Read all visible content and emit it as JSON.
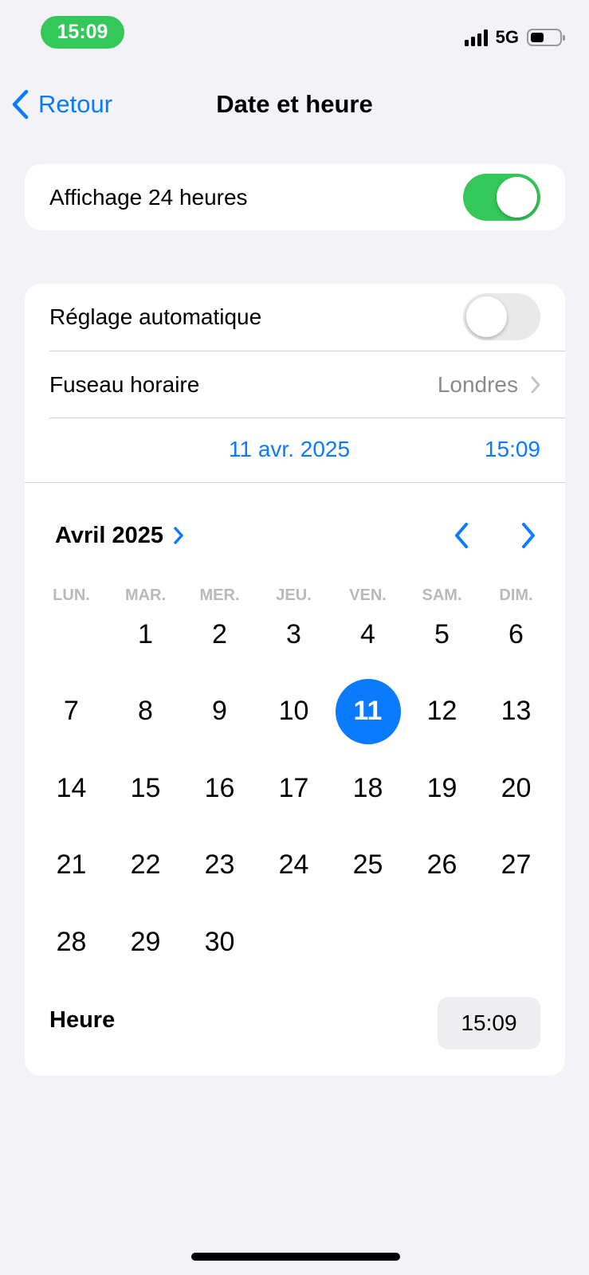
{
  "status_bar": {
    "time": "15:09",
    "network": "5G",
    "signal_bars": 4,
    "battery_level": 0.46
  },
  "nav": {
    "back_label": "Retour",
    "title": "Date et heure",
    "back_icon": "chevron-left-icon"
  },
  "settings": {
    "h24_label": "Affichage 24 heures",
    "h24_on": true,
    "auto_label": "Réglage automatique",
    "auto_on": false,
    "timezone_label": "Fuseau horaire",
    "timezone_value": "Londres"
  },
  "selected_datetime": {
    "date": "11 avr. 2025",
    "time": "15:09"
  },
  "calendar": {
    "month_label": "Avril 2025",
    "weekdays": [
      "LUN.",
      "MAR.",
      "MER.",
      "JEU.",
      "VEN.",
      "SAM.",
      "DIM."
    ],
    "first_weekday_offset": 1,
    "days": [
      "1",
      "2",
      "3",
      "4",
      "5",
      "6",
      "7",
      "8",
      "9",
      "10",
      "11",
      "12",
      "13",
      "14",
      "15",
      "16",
      "17",
      "18",
      "19",
      "20",
      "21",
      "22",
      "23",
      "24",
      "25",
      "26",
      "27",
      "28",
      "29",
      "30"
    ],
    "selected_day": "11"
  },
  "time_row": {
    "label": "Heure",
    "value": "15:09"
  },
  "colors": {
    "accent": "#0a7aff",
    "toggle_on": "#34c759",
    "background": "#f2f2f7",
    "secondary_text": "#8a8a8e"
  }
}
